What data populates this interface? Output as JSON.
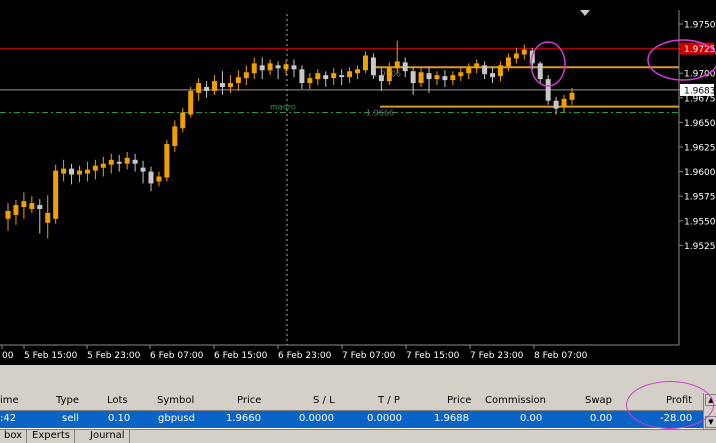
{
  "chart": {
    "price_labels": [
      "1.9750",
      "1.9725",
      "1.9700",
      "1.9683",
      "1.9675",
      "1.9650",
      "1.9625",
      "1.9600",
      "1.9575",
      "1.9550",
      "1.9525"
    ],
    "time_labels": [
      "00",
      "5 Feb 15:00",
      "5 Feb 23:00",
      "6 Feb 07:00",
      "6 Feb 15:00",
      "6 Feb 23:00",
      "7 Feb 07:00",
      "7 Feb 15:00",
      "7 Feb 23:00",
      "8 Feb 07:00"
    ],
    "annotations": {
      "madro": "madro",
      "level_1": "1.9706",
      "level_2": "1.9666"
    },
    "colors": {
      "background": "#000000",
      "bull_candle": "#f0a000",
      "bear_candle": "#c8c8c8",
      "current_price_line": "#cc0000",
      "level_line": "#d89a2a",
      "grid_line": "#9a9a9a",
      "dashed_line": "#2a9a4a",
      "highlight": "#d23cd2"
    }
  },
  "chart_data": {
    "type": "candlestick",
    "symbol": "gbpusd",
    "ylim": [
      1.952,
      1.976
    ],
    "y_ticks": [
      1.9525,
      1.955,
      1.9575,
      1.96,
      1.9625,
      1.965,
      1.9675,
      1.97,
      1.9725,
      1.975
    ],
    "current_price": 1.9725,
    "horizontal_levels": [
      1.9706,
      1.9683,
      1.9666,
      1.966
    ],
    "candles": [
      [
        1.9552,
        1.956,
        1.954,
        1.9568
      ],
      [
        1.9556,
        1.9566,
        1.9546,
        1.9571
      ],
      [
        1.9564,
        1.957,
        1.9552,
        1.9579
      ],
      [
        1.9562,
        1.9568,
        1.9558,
        1.9575
      ],
      [
        1.9566,
        1.9562,
        1.9537,
        1.9572
      ],
      [
        1.9548,
        1.9558,
        1.9532,
        1.9576
      ],
      [
        1.9552,
        1.9601,
        1.9547,
        1.9607
      ],
      [
        1.9598,
        1.9603,
        1.959,
        1.9612
      ],
      [
        1.9603,
        1.9597,
        1.9587,
        1.9608
      ],
      [
        1.9597,
        1.9601,
        1.9589,
        1.9606
      ],
      [
        1.9598,
        1.9602,
        1.959,
        1.961
      ],
      [
        1.9601,
        1.9606,
        1.9592,
        1.9612
      ],
      [
        1.9604,
        1.9608,
        1.9595,
        1.9615
      ],
      [
        1.9607,
        1.9612,
        1.9598,
        1.9618
      ],
      [
        1.961,
        1.9608,
        1.96,
        1.9617
      ],
      [
        1.9608,
        1.9614,
        1.9602,
        1.962
      ],
      [
        1.9612,
        1.9608,
        1.96,
        1.9618
      ],
      [
        1.9604,
        1.96,
        1.9588,
        1.9611
      ],
      [
        1.96,
        1.9588,
        1.958,
        1.9605
      ],
      [
        1.959,
        1.9595,
        1.9585,
        1.96
      ],
      [
        1.9594,
        1.9628,
        1.959,
        1.9632
      ],
      [
        1.9626,
        1.9646,
        1.962,
        1.9652
      ],
      [
        1.9644,
        1.966,
        1.964,
        1.9665
      ],
      [
        1.9658,
        1.9682,
        1.9655,
        1.9686
      ],
      [
        1.968,
        1.969,
        1.9672,
        1.9695
      ],
      [
        1.9686,
        1.9682,
        1.9675,
        1.9692
      ],
      [
        1.9682,
        1.9692,
        1.9678,
        1.9698
      ],
      [
        1.969,
        1.9686,
        1.9678,
        1.9702
      ],
      [
        1.9686,
        1.969,
        1.968,
        1.9698
      ],
      [
        1.969,
        1.9696,
        1.9682,
        1.9703
      ],
      [
        1.9695,
        1.9701,
        1.9688,
        1.9708
      ],
      [
        1.97,
        1.971,
        1.9694,
        1.9716
      ],
      [
        1.9708,
        1.9703,
        1.9694,
        1.9716
      ],
      [
        1.9703,
        1.971,
        1.9698,
        1.9714
      ],
      [
        1.9708,
        1.9705,
        1.9694,
        1.9712
      ],
      [
        1.9704,
        1.9709,
        1.9698,
        1.9713
      ],
      [
        1.9708,
        1.9704,
        1.9696,
        1.9714
      ],
      [
        1.9704,
        1.969,
        1.9684,
        1.9708
      ],
      [
        1.969,
        1.9695,
        1.9684,
        1.97
      ],
      [
        1.9694,
        1.97,
        1.9688,
        1.9704
      ],
      [
        1.9698,
        1.9694,
        1.9686,
        1.9702
      ],
      [
        1.9695,
        1.97,
        1.9688,
        1.9705
      ],
      [
        1.9698,
        1.9696,
        1.9688,
        1.9704
      ],
      [
        1.9696,
        1.9702,
        1.969,
        1.9706
      ],
      [
        1.97,
        1.9704,
        1.9694,
        1.9708
      ],
      [
        1.9703,
        1.9718,
        1.97,
        1.9722
      ],
      [
        1.9716,
        1.9698,
        1.9694,
        1.972
      ],
      [
        1.9698,
        1.9692,
        1.9682,
        1.9705
      ],
      [
        1.9692,
        1.9706,
        1.9688,
        1.9711
      ],
      [
        1.9705,
        1.9712,
        1.97,
        1.9733
      ],
      [
        1.9711,
        1.9702,
        1.9696,
        1.9716
      ],
      [
        1.9702,
        1.969,
        1.9678,
        1.9706
      ],
      [
        1.969,
        1.9701,
        1.9686,
        1.9705
      ],
      [
        1.97,
        1.9694,
        1.968,
        1.9706
      ],
      [
        1.9694,
        1.9698,
        1.9688,
        1.9702
      ],
      [
        1.9697,
        1.9693,
        1.9686,
        1.9703
      ],
      [
        1.9693,
        1.9698,
        1.9688,
        1.9702
      ],
      [
        1.9697,
        1.9701,
        1.9692,
        1.9706
      ],
      [
        1.97,
        1.9706,
        1.9694,
        1.971
      ],
      [
        1.9705,
        1.971,
        1.97,
        1.9714
      ],
      [
        1.9708,
        1.9699,
        1.9694,
        1.9712
      ],
      [
        1.97,
        1.9696,
        1.969,
        1.9706
      ],
      [
        1.9697,
        1.9708,
        1.9692,
        1.9712
      ],
      [
        1.9707,
        1.9716,
        1.9702,
        1.972
      ],
      [
        1.9715,
        1.972,
        1.971,
        1.9726
      ],
      [
        1.9719,
        1.9724,
        1.9714,
        1.9729
      ],
      [
        1.9723,
        1.971,
        1.9704,
        1.9726
      ],
      [
        1.971,
        1.9694,
        1.969,
        1.9712
      ],
      [
        1.9694,
        1.9672,
        1.9668,
        1.9698
      ],
      [
        1.9672,
        1.9664,
        1.9658,
        1.9676
      ],
      [
        1.9666,
        1.9674,
        1.966,
        1.9678
      ],
      [
        1.9673,
        1.968,
        1.9668,
        1.9685
      ]
    ]
  },
  "terminal": {
    "headers": {
      "time": "ime",
      "type": "Type",
      "lots": "Lots",
      "symbol": "Symbol",
      "price": "Price",
      "sl": "S / L",
      "tp": "T / P",
      "price2": "Price",
      "commission": "Commission",
      "swap": "Swap",
      "profit": "Profit"
    },
    "row": {
      "time": ":42",
      "type": "sell",
      "lots": "0.10",
      "symbol": "gbpusd",
      "price": "1.9660",
      "sl": "0.0000",
      "tp": "0.0000",
      "price2": "1.9688",
      "commission": "0.00",
      "swap": "0.00",
      "profit": "-28.00"
    },
    "tabs": [
      "box",
      "Experts",
      "Journal"
    ]
  }
}
